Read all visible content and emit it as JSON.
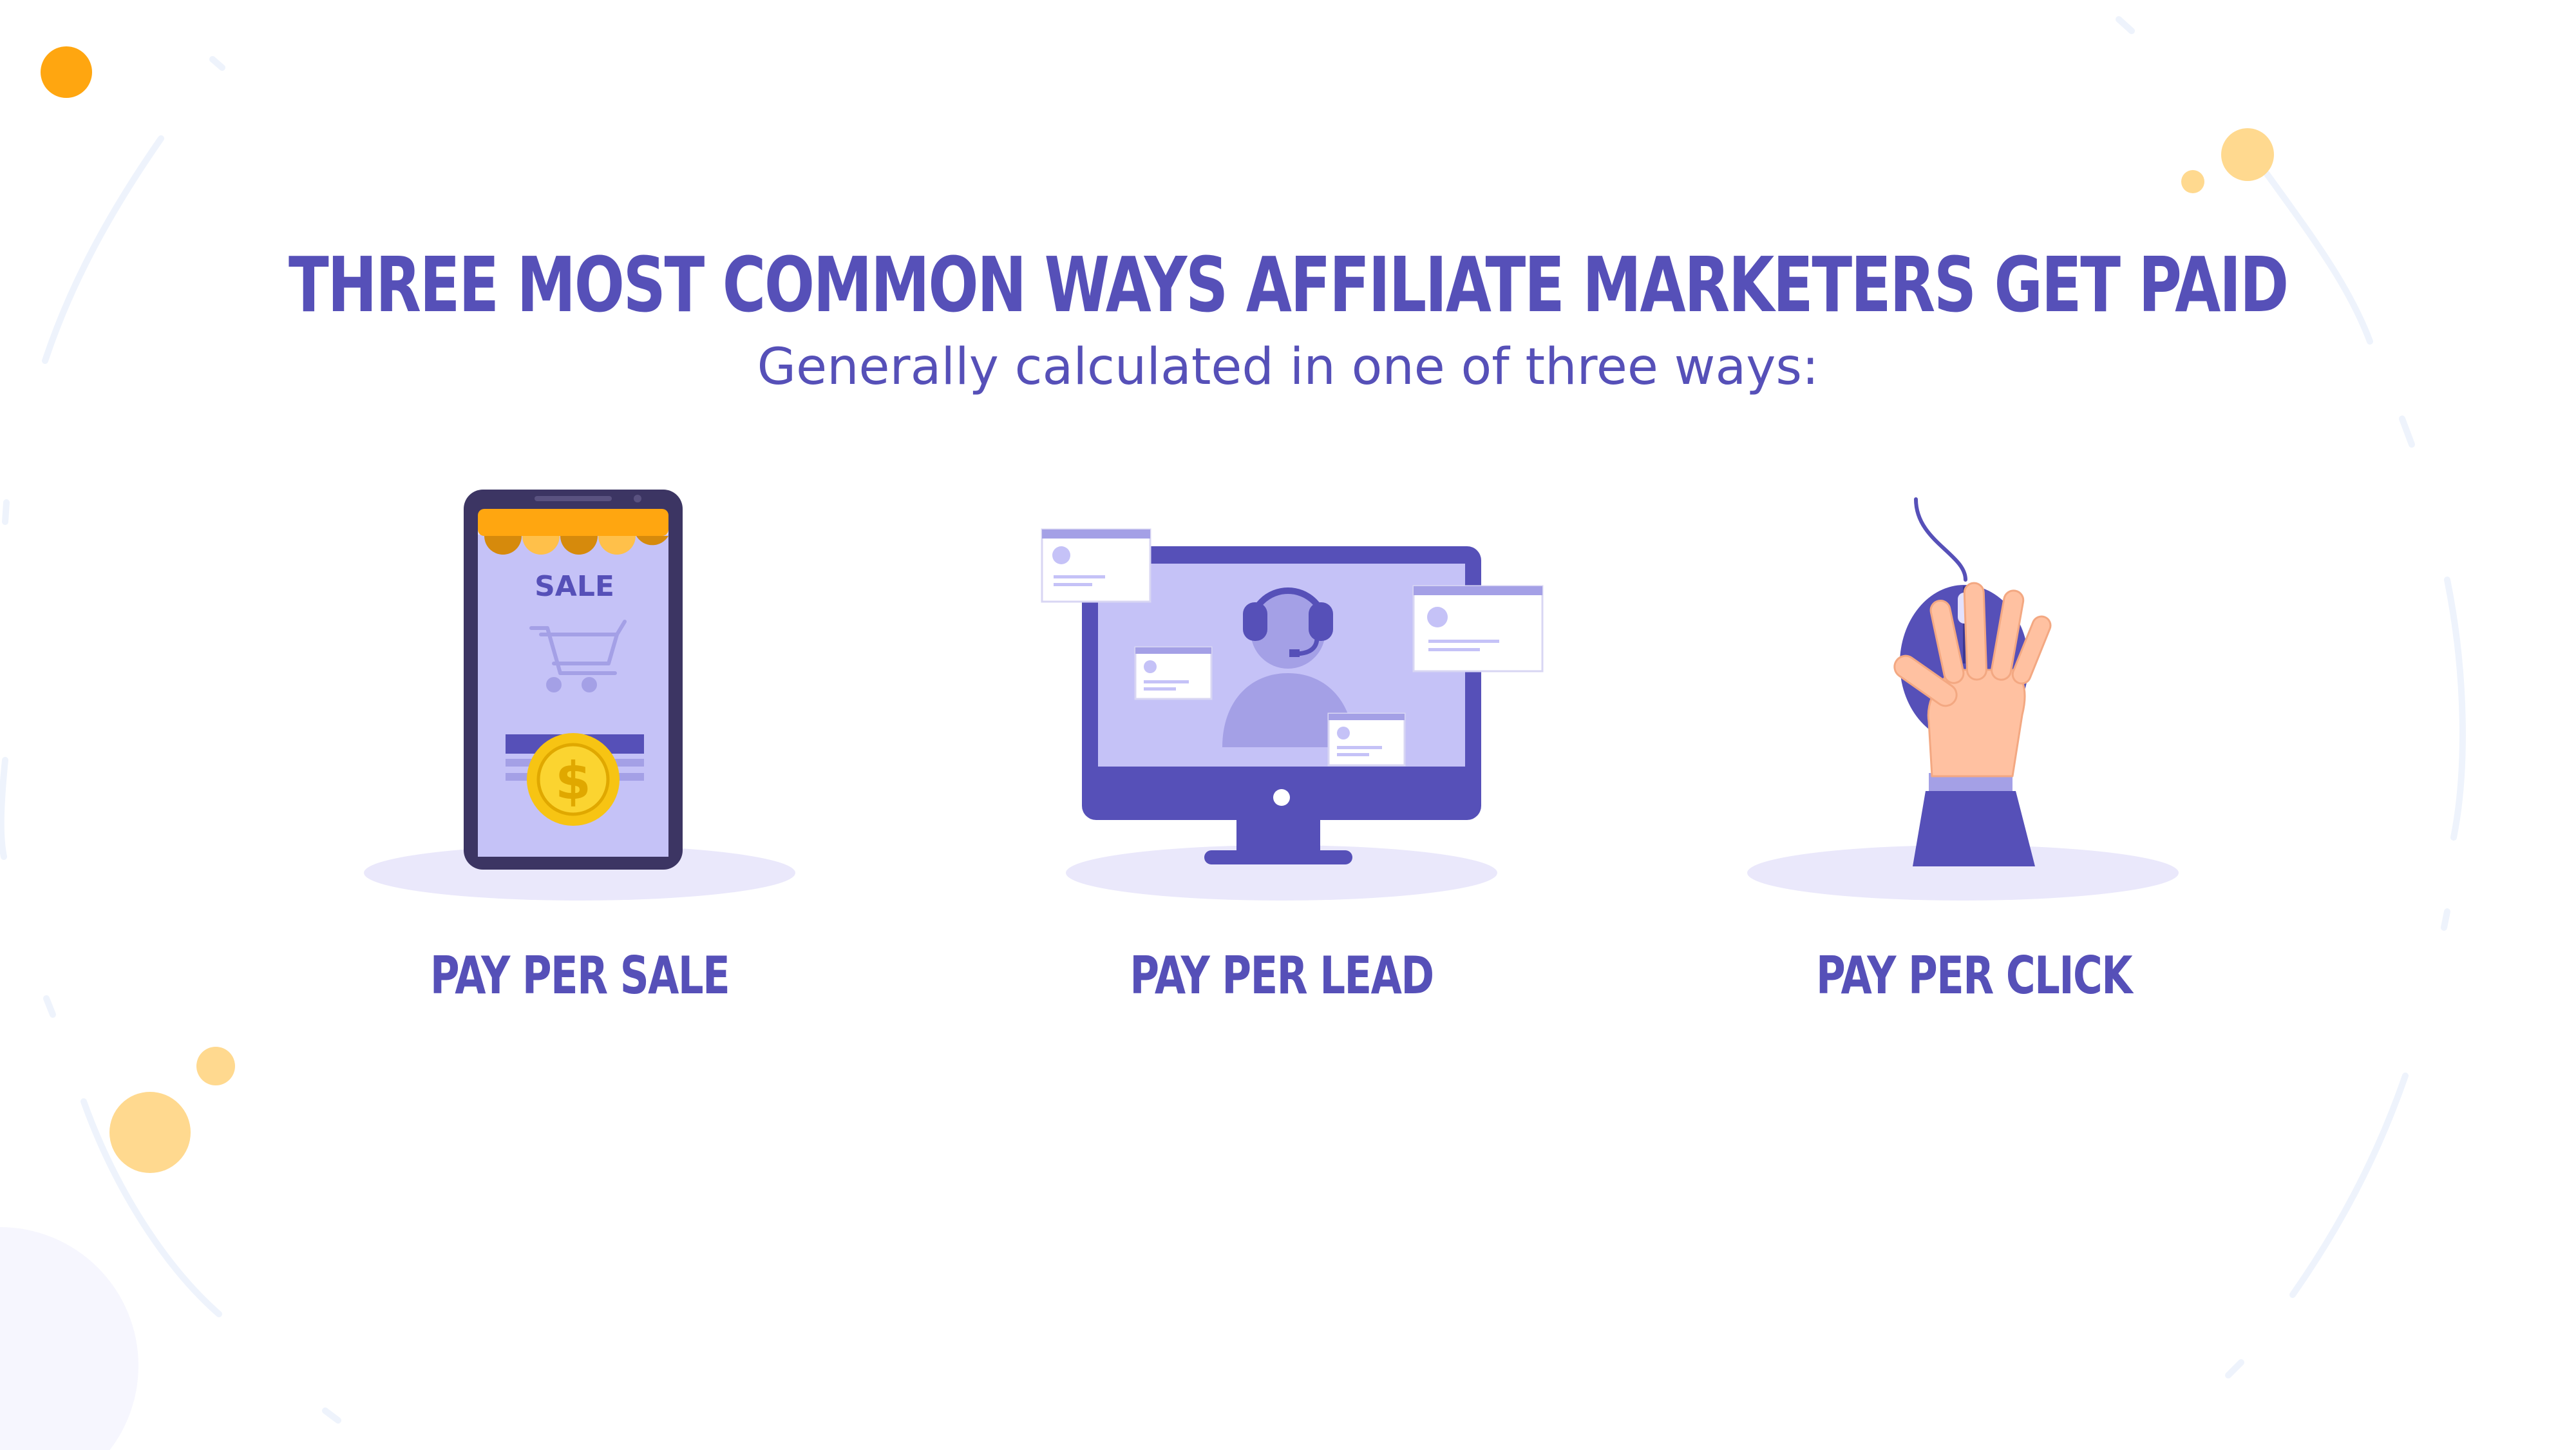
{
  "header": {
    "title": "THREE MOST COMMON WAYS AFFILIATE MARKETERS GET PAID",
    "subtitle": "Generally calculated in one of three ways:"
  },
  "methods": [
    {
      "label": "PAY PER SALE",
      "illustration": "smartphone-shop-icon",
      "sign_text": "SALE",
      "coin_symbol": "$"
    },
    {
      "label": "PAY PER LEAD",
      "illustration": "monitor-support-agent-icon"
    },
    {
      "label": "PAY PER CLICK",
      "illustration": "hand-on-mouse-icon"
    }
  ],
  "colors": {
    "primary": "#5650b8",
    "screen": "#c5c2f7",
    "accent_orange": "#ffa610",
    "accent_light_orange": "#ffd98f",
    "gold": "#f7c413",
    "shadow": "#eae8fb"
  }
}
